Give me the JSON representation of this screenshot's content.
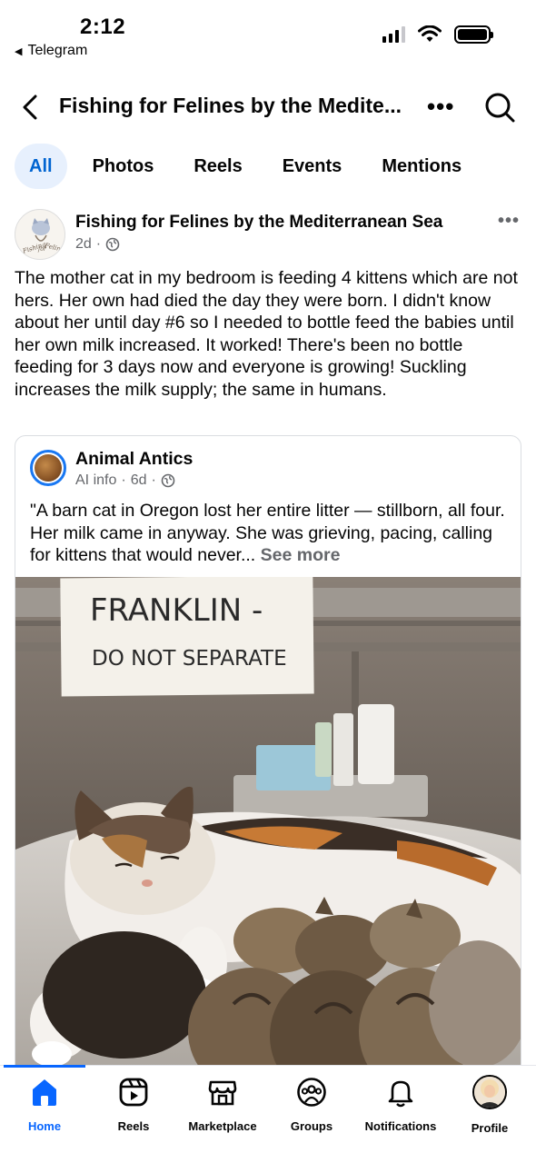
{
  "status_bar": {
    "time": "2:12",
    "back_app": "Telegram"
  },
  "header": {
    "title": "Fishing for Felines by the Medite...",
    "more_label": "•••"
  },
  "tabs": [
    {
      "label": "All",
      "active": true
    },
    {
      "label": "Photos",
      "active": false
    },
    {
      "label": "Reels",
      "active": false
    },
    {
      "label": "Events",
      "active": false
    },
    {
      "label": "Mentions",
      "active": false
    }
  ],
  "post": {
    "author": "Fishing for Felines by the Mediterranean Sea",
    "time": "2d",
    "separator": "·",
    "more_label": "•••",
    "text": "The mother cat in my bedroom is feeding 4 kittens which are not hers. Her own had died the day they were born. I didn't know about her until day #6 so I needed to bottle feed the babies until her own milk increased. It worked! There's been no bottle feeding for 3 days now and everyone is growing! Suckling increases the milk supply; the same in humans.",
    "avatar_text_1": "Fishing",
    "avatar_text_2": "for",
    "avatar_text_3": "Felines"
  },
  "shared": {
    "author": "Animal Antics",
    "meta_label": "AI info",
    "time": "6d",
    "separator": "·",
    "text": "\"A barn cat in Oregon lost her entire litter — stillborn, all four. Her milk came in anyway. She was grieving, pacing, calling for kittens that would never...",
    "see_more": "See more",
    "photo_sign_line1": "FRANKLIN -",
    "photo_sign_line2": "DO NOT SEPARATE"
  },
  "bottom_nav": [
    {
      "label": "Home",
      "icon": "home-icon",
      "active": true
    },
    {
      "label": "Reels",
      "icon": "reels-icon",
      "active": false
    },
    {
      "label": "Marketplace",
      "icon": "marketplace-icon",
      "active": false
    },
    {
      "label": "Groups",
      "icon": "groups-icon",
      "active": false
    },
    {
      "label": "Notifications",
      "icon": "bell-icon",
      "active": false
    },
    {
      "label": "Profile",
      "icon": "profile-avatar",
      "active": false
    }
  ],
  "colors": {
    "accent": "#0866ff",
    "active_tab_bg": "#e7f0fd",
    "active_tab_text": "#0064d1",
    "secondary_text": "#65676b"
  }
}
